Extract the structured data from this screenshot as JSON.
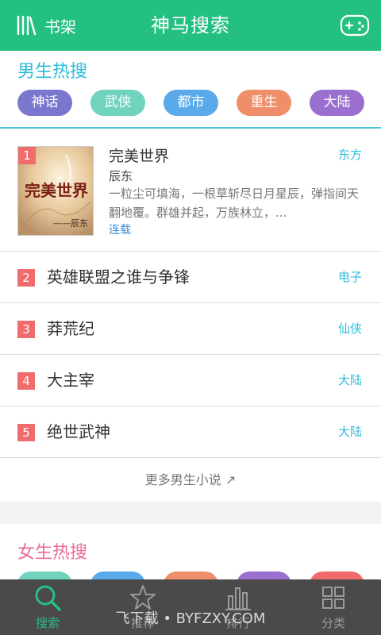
{
  "header": {
    "shelf_label": "书架",
    "title": "神马搜索"
  },
  "boys": {
    "title": "男生热搜",
    "tags": [
      {
        "label": "神话",
        "color": "#7b77cf"
      },
      {
        "label": "武侠",
        "color": "#6fd3bd"
      },
      {
        "label": "都市",
        "color": "#5aa9ea"
      },
      {
        "label": "重生",
        "color": "#ef8f6a"
      },
      {
        "label": "大陆",
        "color": "#9b6fd0"
      }
    ],
    "first": {
      "rank": "1",
      "name": "完美世界",
      "author": "辰东",
      "desc": "一粒尘可填海，一根草斩尽日月星辰，弹指间天翻地覆。群雄并起，万族林立，...",
      "status": "连载",
      "category": "东方",
      "cover_title": "完美世界",
      "cover_author": "——辰东"
    },
    "rows": [
      {
        "rank": "2",
        "name": "英雄联盟之谁与争锋",
        "category": "电子"
      },
      {
        "rank": "3",
        "name": "莽荒纪",
        "category": "仙侠"
      },
      {
        "rank": "4",
        "name": "大主宰",
        "category": "大陆"
      },
      {
        "rank": "5",
        "name": "绝世武神",
        "category": "大陆"
      }
    ],
    "more": "更多男生小说 ↗"
  },
  "girls": {
    "title": "女生热搜",
    "tag_colors": [
      "#6fd3bd",
      "#5aa9ea",
      "#ef8f6a",
      "#9b6fd0",
      "#ef6b6b"
    ]
  },
  "nav": [
    {
      "label": "搜索",
      "icon": "search-icon",
      "active": true
    },
    {
      "label": "推荐",
      "icon": "star-icon",
      "active": false
    },
    {
      "label": "排行",
      "icon": "bar-chart-icon",
      "active": false
    },
    {
      "label": "分类",
      "icon": "grid-icon",
      "active": false
    }
  ],
  "watermark": "飞下载 • BYFZXY.COM",
  "colors": {
    "brand": "#24c082",
    "accent": "#2dbcd9",
    "rank_badge": "#f06b6b",
    "girls_title": "#ea6a9a"
  }
}
